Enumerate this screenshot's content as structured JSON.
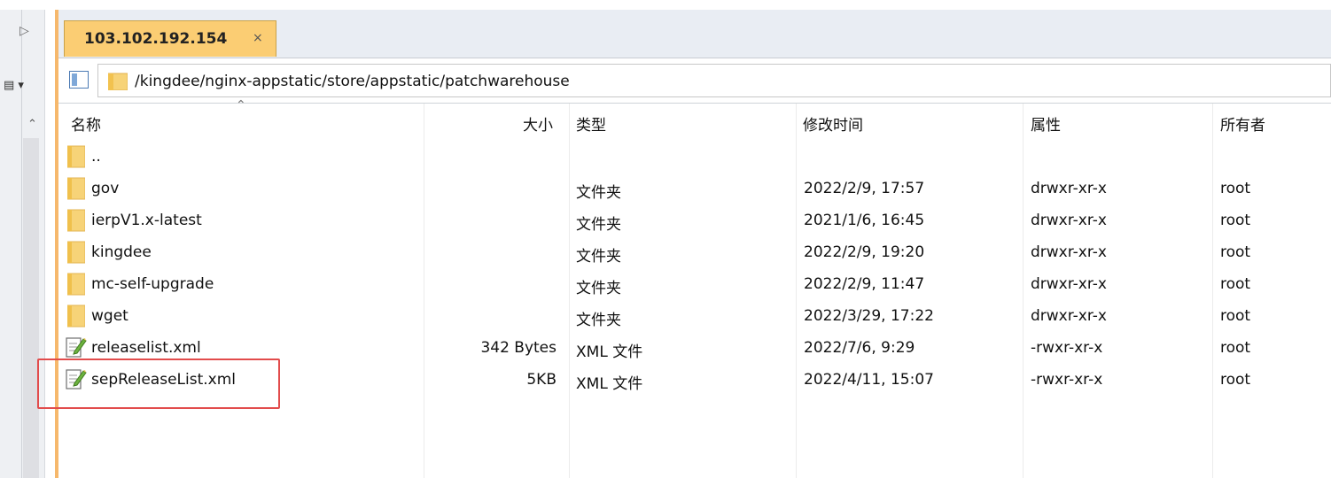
{
  "tab": {
    "title": "103.102.192.154",
    "close": "×"
  },
  "path": "/kingdee/nginx-appstatic/store/appstatic/patchwarehouse",
  "columns": [
    "名称",
    "大小",
    "类型",
    "修改时间",
    "属性",
    "所有者"
  ],
  "rows": [
    {
      "name": "..",
      "size": "",
      "type": "",
      "modified": "",
      "attrs": "",
      "owner": "",
      "icon": "folder-icon"
    },
    {
      "name": "gov",
      "size": "",
      "type": "文件夹",
      "modified": "2022/2/9, 17:57",
      "attrs": "drwxr-xr-x",
      "owner": "root",
      "icon": "folder-icon"
    },
    {
      "name": "ierpV1.x-latest",
      "size": "",
      "type": "文件夹",
      "modified": "2021/1/6, 16:45",
      "attrs": "drwxr-xr-x",
      "owner": "root",
      "icon": "folder-icon"
    },
    {
      "name": "kingdee",
      "size": "",
      "type": "文件夹",
      "modified": "2022/2/9, 19:20",
      "attrs": "drwxr-xr-x",
      "owner": "root",
      "icon": "folder-icon"
    },
    {
      "name": "mc-self-upgrade",
      "size": "",
      "type": "文件夹",
      "modified": "2022/2/9, 11:47",
      "attrs": "drwxr-xr-x",
      "owner": "root",
      "icon": "folder-icon"
    },
    {
      "name": "wget",
      "size": "",
      "type": "文件夹",
      "modified": "2022/3/29, 17:22",
      "attrs": "drwxr-xr-x",
      "owner": "root",
      "icon": "folder-icon"
    },
    {
      "name": "releaselist.xml",
      "size": "342 Bytes",
      "type": "XML 文件",
      "modified": "2022/7/6, 9:29",
      "attrs": "-rwxr-xr-x",
      "owner": "root",
      "icon": "xml-file-icon"
    },
    {
      "name": "sepReleaseList.xml",
      "size": "5KB",
      "type": "XML 文件",
      "modified": "2022/4/11, 15:07",
      "attrs": "-rwxr-xr-x",
      "owner": "root",
      "icon": "xml-file-icon"
    }
  ],
  "colors": {
    "tab": "#fbcd73",
    "frame": "#f6b86c",
    "highlight": "#e24c4c"
  }
}
